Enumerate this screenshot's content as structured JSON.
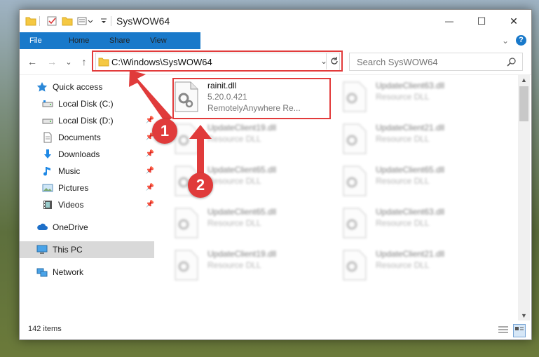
{
  "window": {
    "title": "SysWOW64",
    "minimize_symbol": "—",
    "maximize_symbol": "☐",
    "close_symbol": "✕"
  },
  "ribbon": {
    "tabs": [
      {
        "label": "File"
      },
      {
        "label": "Home"
      },
      {
        "label": "Share"
      },
      {
        "label": "View"
      }
    ],
    "help_symbol": "?"
  },
  "navigation": {
    "back_symbol": "←",
    "forward_symbol": "→",
    "recent_symbol": "⌄",
    "up_symbol": "↑"
  },
  "address": {
    "path": "C:\\Windows\\SysWOW64"
  },
  "search": {
    "placeholder": "Search SysWOW64"
  },
  "sidebar": {
    "items": [
      {
        "label": "Quick access",
        "icon": "star-icon"
      },
      {
        "label": "Local Disk (C:)",
        "icon": "drive-icon"
      },
      {
        "label": "Local Disk (D:)",
        "icon": "drive-icon"
      },
      {
        "label": "Documents",
        "icon": "documents-icon"
      },
      {
        "label": "Downloads",
        "icon": "download-icon"
      },
      {
        "label": "Music",
        "icon": "music-icon"
      },
      {
        "label": "Pictures",
        "icon": "pictures-icon"
      },
      {
        "label": "Videos",
        "icon": "videos-icon"
      },
      {
        "label": "OneDrive",
        "icon": "cloud-icon"
      },
      {
        "label": "This PC",
        "icon": "computer-icon"
      },
      {
        "label": "Network",
        "icon": "network-icon"
      }
    ]
  },
  "files": [
    {
      "name": "rainit.dll",
      "version": "5.20.0.421",
      "description": "RemotelyAnywhere Re..."
    },
    {
      "name": "UpdateClient63.dll",
      "description": "Resource DLL"
    },
    {
      "name": "UpdateClient19.dll",
      "description": "Resource DLL"
    },
    {
      "name": "UpdateClient21.dll",
      "description": "Resource DLL"
    },
    {
      "name": "UpdateClient65.dll",
      "description": "Resource DLL"
    },
    {
      "name": "UpdateClient65.dll",
      "description": "Resource DLL"
    },
    {
      "name": "UpdateClient65.dll",
      "description": "Resource DLL"
    },
    {
      "name": "UpdateClient63.dll",
      "description": "Resource DLL"
    },
    {
      "name": "UpdateClient19.dll",
      "description": "Resource DLL"
    },
    {
      "name": "UpdateClient21.dll",
      "description": "Resource DLL"
    }
  ],
  "status": {
    "item_count": "142 items"
  },
  "annotations": {
    "step1": "1",
    "step2": "2"
  },
  "colors": {
    "accent": "#1979ca",
    "highlight_red": "#e23b3b",
    "selected": "#d9d9d9"
  }
}
